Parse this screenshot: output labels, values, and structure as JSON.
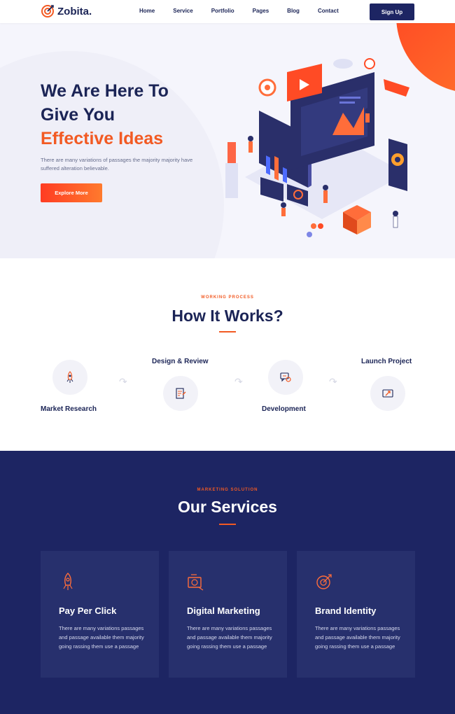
{
  "brand": {
    "name": "Zobita.",
    "accent": "#f25a23",
    "navy": "#1d2563"
  },
  "nav": {
    "items": [
      "Home",
      "Service",
      "Portfolio",
      "Pages",
      "Blog",
      "Contact"
    ],
    "signup_label": "Sign Up"
  },
  "hero": {
    "title_line1": "We Are Here To",
    "title_line2": "Give You",
    "title_line3": "Effective Ideas",
    "description": "There are many variations of passages the majority majority have suffered alteration believable.",
    "button_label": "Explore More",
    "illustration": "isometric-analytics-dashboard-illustration"
  },
  "works": {
    "eyebrow": "WORKING PROCESS",
    "title": "How It Works?",
    "steps": [
      {
        "label": "Market Research",
        "icon": "rocket-icon"
      },
      {
        "label": "Design & Review",
        "icon": "document-pen-icon"
      },
      {
        "label": "Development",
        "icon": "chat-gear-icon"
      },
      {
        "label": "Launch Project",
        "icon": "launch-icon"
      }
    ]
  },
  "services": {
    "eyebrow": "MARKETING SOLUTION",
    "title": "Our Services",
    "cards": [
      {
        "title": "Pay Per Click",
        "text": "There are many variations passages and passage available them majority going rassing them use a passage",
        "icon": "rocket-icon"
      },
      {
        "title": "Digital Marketing",
        "text": "There are many variations passages and passage available them majority going rassing them use a passage",
        "icon": "marketing-icon"
      },
      {
        "title": "Brand Identity",
        "text": "There are many variations passages and passage available them majority going rassing them use a passage",
        "icon": "target-icon"
      }
    ]
  }
}
